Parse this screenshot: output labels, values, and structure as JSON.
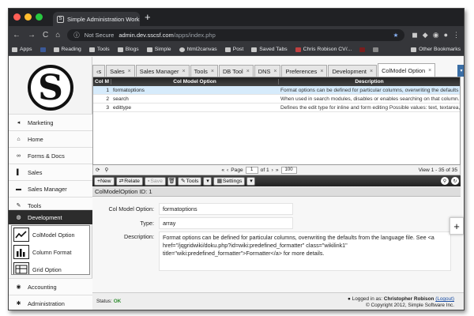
{
  "browser": {
    "tab_title": "Simple Administration Workp...",
    "tab_close": "×",
    "new_tab": "+",
    "nav_back": "←",
    "nav_forward": "→",
    "nav_reload": "C",
    "nav_home": "⌂",
    "security_label": "Not Secure",
    "url_host": "admin.dev.sscsf.com",
    "url_path": "/apps/index.php",
    "bookmarks": [
      "Apps",
      "",
      "Reading",
      "Tools",
      "Blogs",
      "Simple",
      "html2canvas",
      "Post",
      "Saved Tabs",
      "Chris Robison CV/...",
      "",
      ""
    ],
    "other_bookmarks": "Other Bookmarks"
  },
  "logo": {
    "letter": "S"
  },
  "sidebar": {
    "items": [
      {
        "label": "Marketing",
        "icon": "megaphone-icon",
        "glyph": "◂"
      },
      {
        "label": "Home",
        "icon": "home-icon",
        "glyph": "⌂"
      },
      {
        "label": "Forms & Docs",
        "icon": "link-icon",
        "glyph": "∞"
      },
      {
        "label": "Sales",
        "icon": "bar-icon",
        "glyph": "▌"
      },
      {
        "label": "Sales Manager",
        "icon": "users-icon",
        "glyph": "▬"
      },
      {
        "label": "Tools",
        "icon": "wrench-icon",
        "glyph": "✎"
      },
      {
        "label": "Development",
        "icon": "gear-icon",
        "glyph": "◍"
      }
    ],
    "sub_items": [
      {
        "label": "ColModel Option"
      },
      {
        "label": "Column Format"
      },
      {
        "label": "Grid Option"
      }
    ],
    "bottom_items": [
      {
        "label": "Accounting",
        "icon": "money-icon",
        "glyph": "◉"
      },
      {
        "label": "Administration",
        "icon": "cog-icon",
        "glyph": "✱"
      }
    ]
  },
  "app_tabs": {
    "left_partial": "‹s",
    "tabs": [
      "Sales",
      "Sales Manager",
      "Tools",
      "DB Tool",
      "DNS",
      "Preferences",
      "Development",
      "ColModel Option"
    ],
    "active_index": 7,
    "close_glyph": "×",
    "scroll_glyph": "▾"
  },
  "grid": {
    "headers": [
      "Col M",
      "Col Model Option",
      "Description"
    ],
    "rows": [
      {
        "num": "1",
        "option": "formatoptions",
        "desc": "Format options can be defined for particular columns, overwriting the defaults fro",
        "selected": true
      },
      {
        "num": "2",
        "option": "search",
        "desc": "When used in search modules, disables or enables searching on that column.  Sea",
        "selected": false
      },
      {
        "num": "3",
        "option": "edittype",
        "desc": "Defines the edit type for inline and form editing Possible values: text, textarea, sele",
        "selected": false
      }
    ]
  },
  "pager": {
    "first": "«",
    "prev": "‹",
    "page_label": "Page",
    "page_value": "1",
    "of_label": "of 1",
    "next": "›",
    "last": "»",
    "rows_value": "100",
    "view_text": "View 1 - 35 of 35"
  },
  "grid_toolbar": {
    "new": "+New",
    "relate": "Relate",
    "save": "Save",
    "delete": "🗑",
    "tools": "Tools",
    "settings": "Settings",
    "dropdown": "▾",
    "right_icon1": "⚲",
    "right_icon2": "↻"
  },
  "record": {
    "id_label": "ColModelOption ID: 1",
    "fields": [
      {
        "label": "Col Model Option:",
        "value": "formatoptions"
      },
      {
        "label": "Type:",
        "value": "array"
      },
      {
        "label": "Description:",
        "value": "Format options can be defined for particular columns, overwriting the defaults from the language file. See <a href=\"/jqgridwiki/doku.php?id=wiki:predefined_formatter\" class=\"wikilink1\" title=\"wiki:predefined_formatter\">Formatter</a> for more details."
      }
    ],
    "plus": "+"
  },
  "status": {
    "label": "Status:",
    "value": "OK",
    "logged_in_prefix": "Logged in as:",
    "user": "Christopher Robison",
    "logout": "(Logout)",
    "copyright": "© Copyright 2012, Simple Software Inc."
  },
  "colors": {
    "chrome_dark": "#202124",
    "accent_blue": "#3a6ea5",
    "status_ok": "#2e8b2e",
    "selected_row": "#d6ebfb"
  }
}
